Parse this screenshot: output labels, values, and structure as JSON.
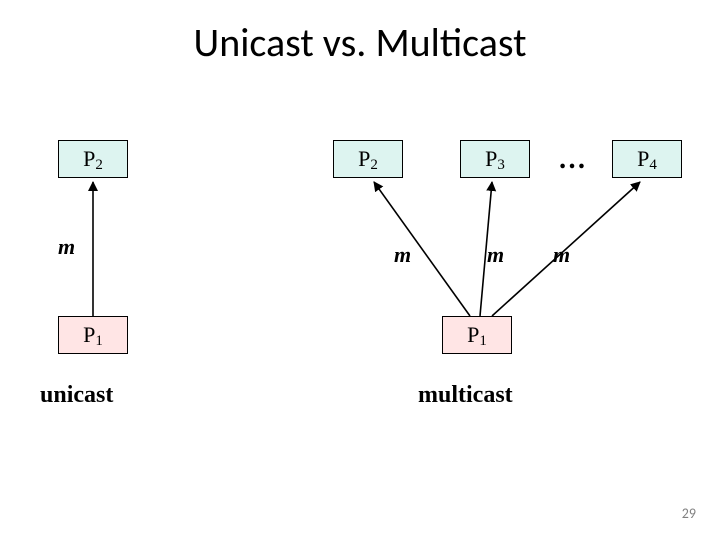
{
  "title": "Unicast vs. Multicast",
  "page_number": "29",
  "unicast": {
    "dest": "P",
    "dest_sub": "2",
    "src": "P",
    "src_sub": "1",
    "m": "m",
    "label": "unicast"
  },
  "multicast": {
    "d1": "P",
    "d1_sub": "2",
    "d2": "P",
    "d2_sub": "3",
    "d3": "P",
    "d3_sub": "4",
    "src": "P",
    "src_sub": "1",
    "ell": "…",
    "m1": "m",
    "m2": "m",
    "m3": "m",
    "label": "multicast"
  },
  "colors": {
    "dest_fill": "#ddf4f0",
    "src_fill": "#ffe5e5",
    "stroke": "#000000"
  }
}
